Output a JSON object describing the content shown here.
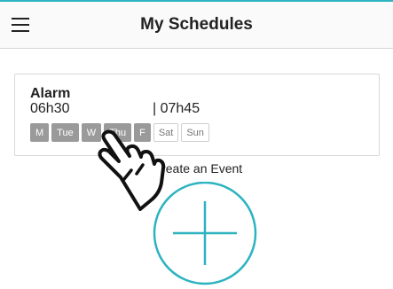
{
  "app_bar": {
    "menu_icon": "hamburger-menu-icon",
    "title": "My Schedules"
  },
  "schedule_card": {
    "name": "Alarm",
    "start_time": "06h30",
    "end_time": "| 07h45",
    "days": [
      {
        "label": "M",
        "active": true
      },
      {
        "label": "Tue",
        "active": true
      },
      {
        "label": "W",
        "active": true
      },
      {
        "label": "Thu",
        "active": true
      },
      {
        "label": "F",
        "active": true
      },
      {
        "label": "Sat",
        "active": false
      },
      {
        "label": "Sun",
        "active": false
      }
    ]
  },
  "create_event": {
    "label": "Create an Event",
    "icon": "plus-circle-icon"
  },
  "overlay": {
    "icon": "pointing-hand-icon"
  },
  "colors": {
    "accent": "#2db3c0",
    "day_active_bg": "#9a9a9a",
    "day_inactive_border": "#cfcfcf"
  }
}
